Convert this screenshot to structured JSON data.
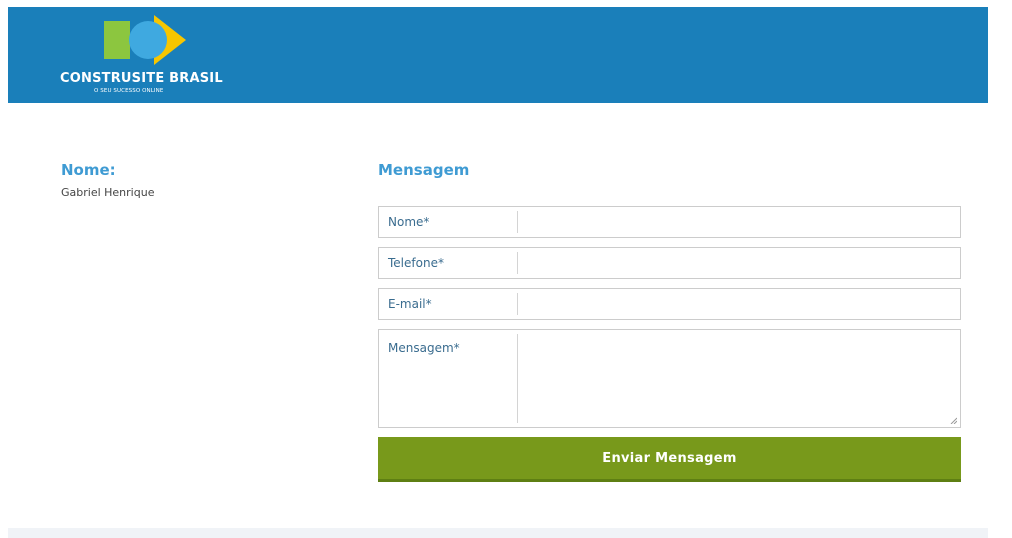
{
  "header": {
    "logo_title": "CONSTRUSITE BRASIL",
    "logo_subtitle": "O SEU SUCESSO ONLINE",
    "colors": {
      "background": "#1a7fba",
      "logo_green": "#8cc63f",
      "logo_yellow": "#f7c600",
      "logo_blue": "#3fa9e0"
    }
  },
  "client": {
    "label": "Nome:",
    "name": "Gabriel Henrique"
  },
  "form": {
    "title": "Mensagem",
    "fields": [
      {
        "label": "Nome*",
        "value": ""
      },
      {
        "label": "Telefone*",
        "value": ""
      },
      {
        "label": "E-mail*",
        "value": ""
      },
      {
        "label": "Mensagem*",
        "value": ""
      }
    ],
    "submit_label": "Enviar Mensagem",
    "submit_color": "#78991b"
  }
}
